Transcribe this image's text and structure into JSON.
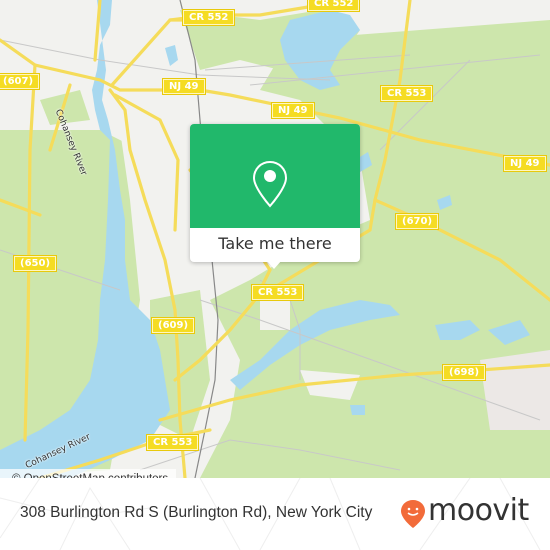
{
  "map": {
    "road_shields": [
      {
        "id": "cr552-top",
        "label": "CR 552"
      },
      {
        "id": "cr552-left",
        "label": "CR 552"
      },
      {
        "id": "607",
        "label": "(607)"
      },
      {
        "id": "nj49-a",
        "label": "NJ 49"
      },
      {
        "id": "nj49-b",
        "label": "NJ 49"
      },
      {
        "id": "cr553-top",
        "label": "CR 553"
      },
      {
        "id": "nj49-c",
        "label": "NJ 49"
      },
      {
        "id": "670",
        "label": "(670)"
      },
      {
        "id": "650",
        "label": "(650)"
      },
      {
        "id": "609",
        "label": "(609)"
      },
      {
        "id": "cr553-mid",
        "label": "CR 553"
      },
      {
        "id": "698",
        "label": "(698)"
      },
      {
        "id": "cr553-bottom",
        "label": "CR 553"
      }
    ],
    "river_labels": [
      {
        "id": "cohansey-top",
        "label": "Cohansey River"
      },
      {
        "id": "cohansey-bottom",
        "label": "Cohansey River"
      }
    ],
    "attribution": "© OpenStreetMap contributors",
    "colors": {
      "land": "#f2f2ef",
      "forest": "#cde6ac",
      "water": "#a7d8ef",
      "road": "#f5dc5a",
      "brand_green": "#21b86b",
      "moovit_orange": "#f26b3a"
    }
  },
  "popup": {
    "icon": "location-pin-icon",
    "cta_label": "Take me there"
  },
  "footer": {
    "address": "308 Burlington Rd S (Burlington Rd), New York City",
    "logo_text": "moovit"
  }
}
